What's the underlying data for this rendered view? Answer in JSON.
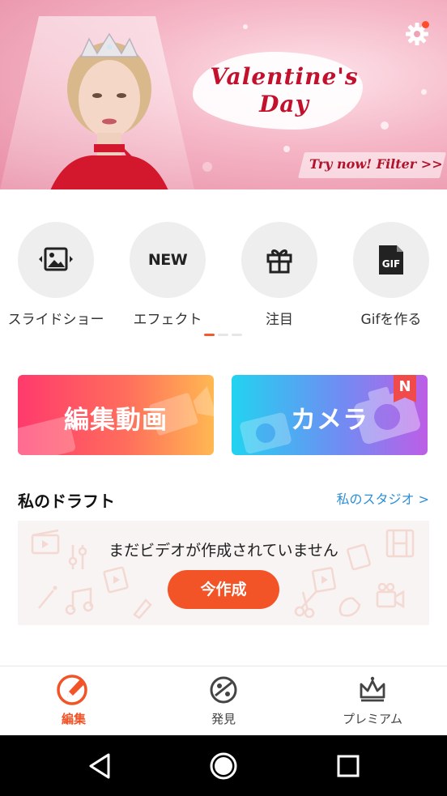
{
  "banner": {
    "title_line1": "Valentine's",
    "title_line2": "Day",
    "cta": "Try now! Filter >>"
  },
  "shortcuts": [
    {
      "label": "スライドショー",
      "icon": "image-slideshow-icon"
    },
    {
      "label": "エフェクト",
      "icon": "new-effects-icon",
      "badge_text": "NEW"
    },
    {
      "label": "注目",
      "icon": "gift-icon"
    },
    {
      "label": "Gifを作る",
      "icon": "gif-file-icon",
      "badge_text": "GIF"
    }
  ],
  "actions": {
    "edit_label": "編集動画",
    "camera_label": "カメラ",
    "camera_badge": "N"
  },
  "drafts": {
    "title": "私のドラフト",
    "studio_link": "私のスタジオ >",
    "empty_message": "まだビデオが作成されていません",
    "create_button": "今作成"
  },
  "bottom_nav": [
    {
      "label": "編集",
      "icon": "pencil-icon",
      "active": true
    },
    {
      "label": "発見",
      "icon": "discover-icon",
      "active": false
    },
    {
      "label": "プレミアム",
      "icon": "crown-icon",
      "active": false
    }
  ],
  "colors": {
    "accent": "#f25428",
    "link": "#2d8fd6",
    "inactive_nav": "#444444"
  }
}
